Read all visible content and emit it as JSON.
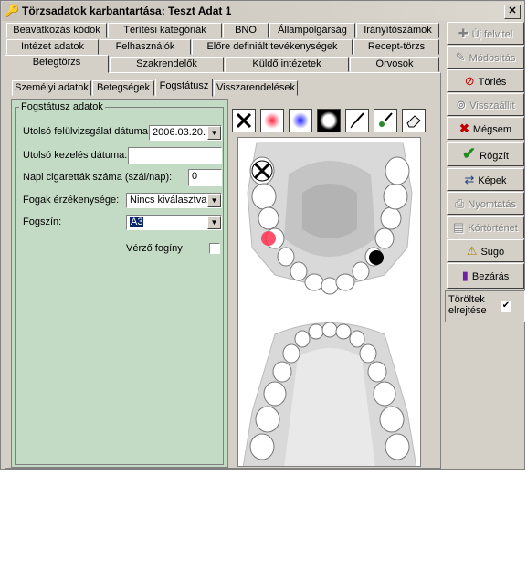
{
  "window": {
    "title": "Törzsadatok karbantartása: Teszt Adat 1",
    "close": "✕"
  },
  "tabs_row1": [
    "Beavatkozás kódok",
    "Térítési kategóriák",
    "BNO",
    "Állampolgárság",
    "Irányítószámok"
  ],
  "tabs_row2": [
    "Intézet adatok",
    "Felhasználók",
    "Előre definiált tevékenységek",
    "Recept-törzs"
  ],
  "tabs_row3": [
    "Betegtörzs",
    "Szakrendelők",
    "Küldő intézetek",
    "Orvosok"
  ],
  "subtabs": [
    "Személyi adatok",
    "Betegségek",
    "Fogstátusz",
    "Visszarendelések"
  ],
  "form": {
    "legend": "Fogstátusz adatok",
    "last_check_label": "Utolsó felülvizsgálat dátuma:",
    "last_check_value": "2006.03.20.",
    "last_treatment_label": "Utolsó kezelés dátuma:",
    "last_treatment_value": "",
    "cigarettes_label": "Napi cigaretták száma (szál/nap):",
    "cigarettes_value": "0",
    "sensitivity_label": "Fogak érzékenysége:",
    "sensitivity_value": "Nincs kiválasztva",
    "tooth_color_label": "Fogszín:",
    "tooth_color_value": "A3",
    "bleeding_label": "Vérző fogíny",
    "bleeding_checked": false
  },
  "tools": [
    "cross-tool",
    "red-dot-tool",
    "blue-dot-tool",
    "white-dot-tool",
    "brush-tool",
    "green-brush-tool",
    "eraser-tool"
  ],
  "sidebar": {
    "new": "Új felvitel",
    "modify": "Módosítás",
    "delete": "Törlés",
    "restore": "Visszaállít",
    "cancel": "Mégsem",
    "save": "Rögzít",
    "images": "Képek",
    "print": "Nyomtatás",
    "history": "Kórtörténet",
    "help": "Súgó",
    "close": "Bezárás",
    "hide_deleted": "Töröltek elrejtése",
    "hide_deleted_checked": true
  },
  "colors": {
    "panel_green": "#c3dac5",
    "selection": "#0a246a",
    "face": "#d4d0c8"
  }
}
